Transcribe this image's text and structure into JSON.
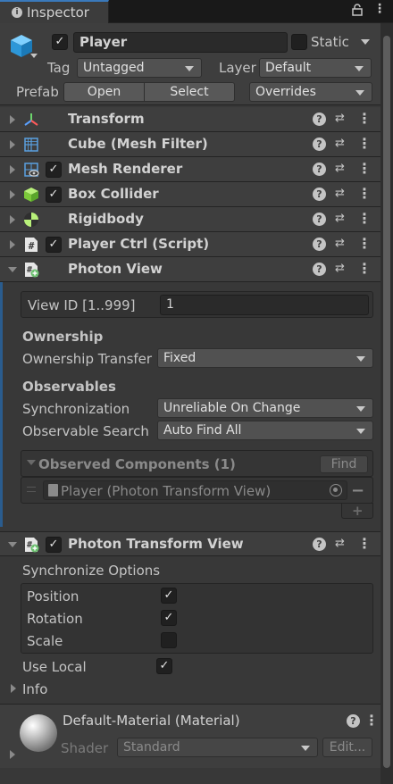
{
  "tab": {
    "title": "Inspector"
  },
  "header": {
    "name": "Player",
    "static_label": "Static",
    "tag_label": "Tag",
    "tag_value": "Untagged",
    "layer_label": "Layer",
    "layer_value": "Default",
    "prefab_label": "Prefab",
    "open_label": "Open",
    "select_label": "Select",
    "overrides_label": "Overrides"
  },
  "components": [
    {
      "name": "Transform",
      "icon": "transform-icon",
      "has_checkbox": false
    },
    {
      "name": "Cube (Mesh Filter)",
      "icon": "mesh-filter-icon",
      "has_checkbox": false
    },
    {
      "name": "Mesh Renderer",
      "icon": "mesh-renderer-icon",
      "has_checkbox": true
    },
    {
      "name": "Box Collider",
      "icon": "box-collider-icon",
      "has_checkbox": true
    },
    {
      "name": "Rigidbody",
      "icon": "rigidbody-icon",
      "has_checkbox": false
    },
    {
      "name": "Player Ctrl (Script)",
      "icon": "script-icon",
      "has_checkbox": true
    },
    {
      "name": "Photon View",
      "icon": "photon-icon",
      "has_checkbox": false
    }
  ],
  "photon_view": {
    "view_id_label": "View ID [1..999]",
    "view_id_value": "1",
    "ownership_heading": "Ownership",
    "ownership_transfer_label": "Ownership Transfer",
    "ownership_transfer_value": "Fixed",
    "observables_heading": "Observables",
    "synchronization_label": "Synchronization",
    "synchronization_value": "Unreliable On Change",
    "observable_search_label": "Observable Search",
    "observable_search_value": "Auto Find All",
    "observed_components_label": "Observed Components (1)",
    "find_label": "Find",
    "observed_item": "Player (Photon Transform View)"
  },
  "photon_transform_view": {
    "name": "Photon Transform View",
    "sync_options_label": "Synchronize Options",
    "options": [
      {
        "label": "Position",
        "checked": true
      },
      {
        "label": "Rotation",
        "checked": true
      },
      {
        "label": "Scale",
        "checked": false
      }
    ],
    "use_local_label": "Use Local",
    "use_local_checked": true,
    "info_label": "Info"
  },
  "material": {
    "name": "Default-Material (Material)",
    "shader_label": "Shader",
    "shader_value": "Standard",
    "edit_label": "Edit..."
  },
  "colors": {
    "accent": "#3a79bb",
    "background": "#383838"
  }
}
